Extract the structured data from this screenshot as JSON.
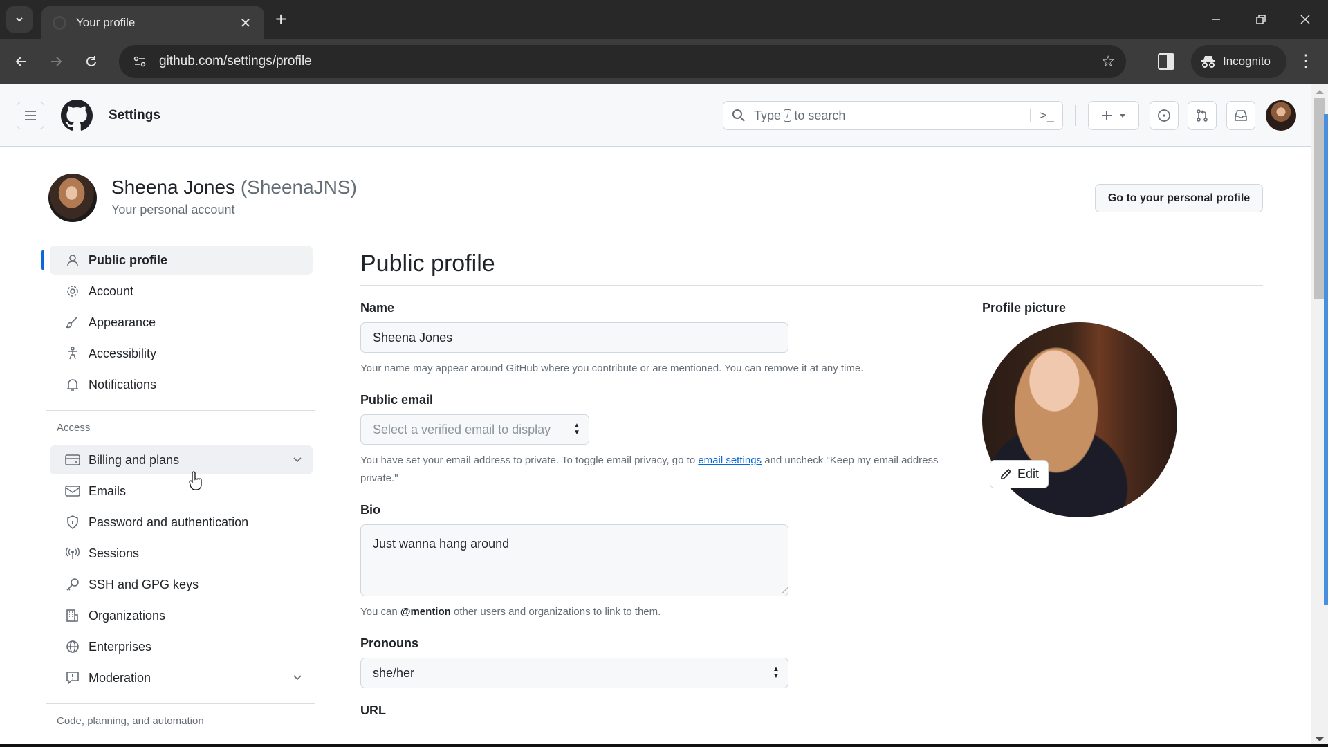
{
  "browser": {
    "tab_title": "Your profile",
    "url": "github.com/settings/profile",
    "incognito_label": "Incognito"
  },
  "header": {
    "context": "Settings",
    "search_prefix": "Type",
    "search_key": "/",
    "search_suffix": "to search",
    "command_glyph": ">_"
  },
  "account": {
    "display_name": "Sheena Jones",
    "login": "(SheenaJNS)",
    "subtitle": "Your personal account",
    "goto_profile_label": "Go to your personal profile"
  },
  "sidebar": {
    "items": [
      {
        "label": "Public profile",
        "icon": "person-icon",
        "active": true
      },
      {
        "label": "Account",
        "icon": "gear-icon"
      },
      {
        "label": "Appearance",
        "icon": "paintbrush-icon"
      },
      {
        "label": "Accessibility",
        "icon": "accessibility-icon"
      },
      {
        "label": "Notifications",
        "icon": "bell-icon"
      }
    ],
    "access_heading": "Access",
    "access_items": [
      {
        "label": "Billing and plans",
        "icon": "credit-card-icon",
        "expandable": true
      },
      {
        "label": "Emails",
        "icon": "mail-icon"
      },
      {
        "label": "Password and authentication",
        "icon": "shield-lock-icon"
      },
      {
        "label": "Sessions",
        "icon": "broadcast-icon"
      },
      {
        "label": "SSH and GPG keys",
        "icon": "key-icon"
      },
      {
        "label": "Organizations",
        "icon": "organization-icon"
      },
      {
        "label": "Enterprises",
        "icon": "globe-icon"
      },
      {
        "label": "Moderation",
        "icon": "report-icon",
        "expandable": true
      }
    ],
    "code_heading": "Code, planning, and automation"
  },
  "main": {
    "title": "Public profile",
    "name_label": "Name",
    "name_value": "Sheena Jones",
    "name_note": "Your name may appear around GitHub where you contribute or are mentioned. You can remove it at any time.",
    "email_label": "Public email",
    "email_placeholder": "Select a verified email to display",
    "email_note_prefix": "You have set your email address to private. To toggle email privacy, go to ",
    "email_note_link": "email settings",
    "email_note_suffix": " and uncheck \"Keep my email address private.\"",
    "bio_label": "Bio",
    "bio_value": "Just wanna hang around",
    "bio_note_prefix": "You can ",
    "bio_note_bold": "@mention",
    "bio_note_suffix": " other users and organizations to link to them.",
    "pronouns_label": "Pronouns",
    "pronouns_value": "she/her",
    "url_label": "URL",
    "picture_label": "Profile picture",
    "edit_label": "Edit"
  }
}
